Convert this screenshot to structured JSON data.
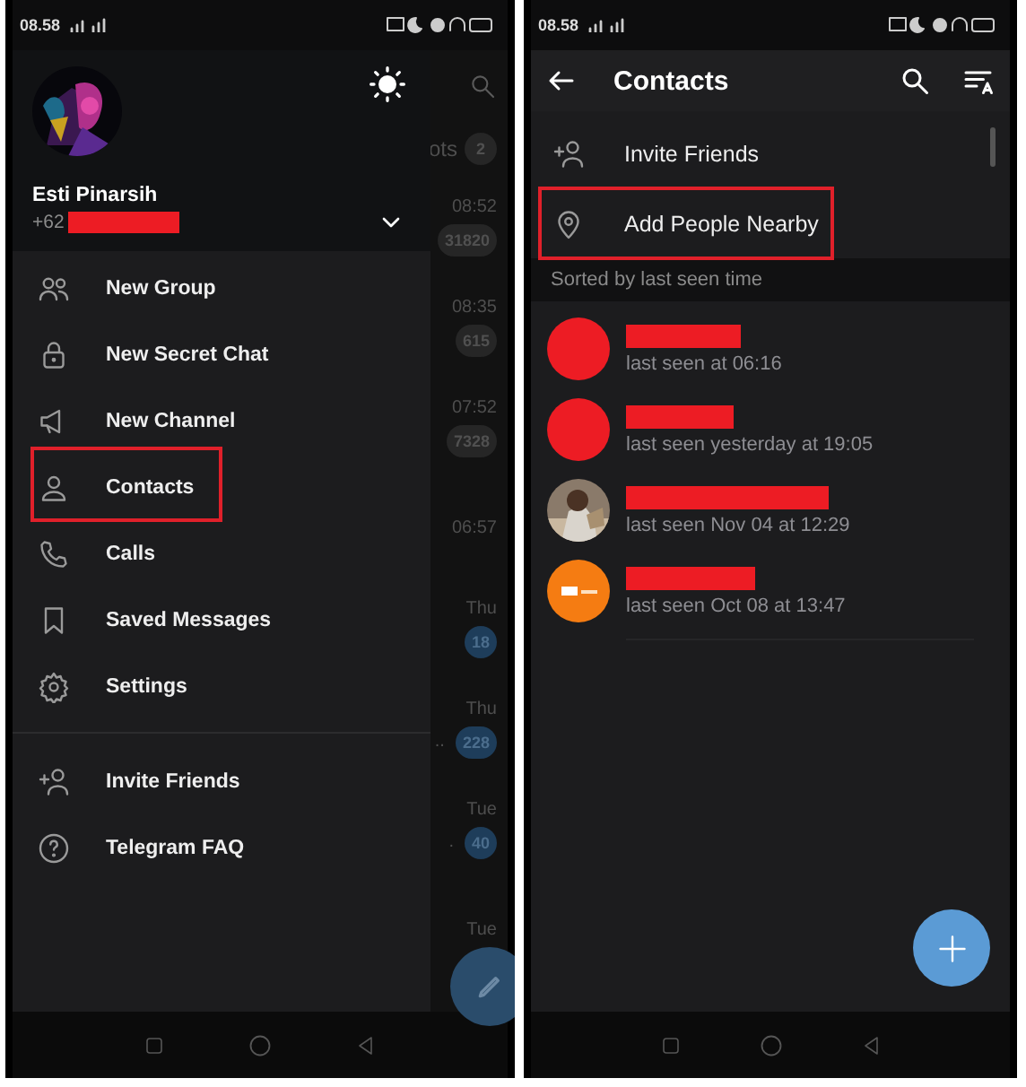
{
  "left_phone": {
    "status_bar": {
      "time": "08.58"
    },
    "behind_chats": {
      "tab": {
        "label": "ots",
        "badge": "2"
      },
      "rows": [
        {
          "time": "08:52",
          "badge": "31820",
          "muted": true
        },
        {
          "time": "08:35",
          "badge": "615",
          "muted": true
        },
        {
          "time": "07:52",
          "badge": "7328",
          "muted": true
        },
        {
          "time": "06:57"
        },
        {
          "time": "Thu",
          "badge": "18",
          "muted": false
        },
        {
          "time": "Thu",
          "badge": "228",
          "muted": false,
          "preview": ".."
        },
        {
          "time": "Tue",
          "badge": "40",
          "muted": false,
          "preview": "."
        },
        {
          "time": "Tue"
        }
      ]
    },
    "drawer": {
      "user": {
        "name": "Esti Pinarsih",
        "phone": "+62",
        "phone_redacted": true
      },
      "menu": [
        {
          "label": "New Group",
          "kind": "group",
          "highlighted": false
        },
        {
          "label": "New Secret Chat",
          "kind": "lock",
          "highlighted": false
        },
        {
          "label": "New Channel",
          "kind": "megaphone",
          "highlighted": false
        },
        {
          "label": "Contacts",
          "kind": "person",
          "highlighted": true
        },
        {
          "label": "Calls",
          "kind": "phone",
          "highlighted": false
        },
        {
          "label": "Saved Messages",
          "kind": "bookmark",
          "highlighted": false
        },
        {
          "label": "Settings",
          "kind": "gear",
          "highlighted": false
        }
      ],
      "footer_menu": [
        {
          "label": "Invite Friends",
          "kind": "invite",
          "highlighted": false
        },
        {
          "label": "Telegram FAQ",
          "kind": "help",
          "highlighted": false
        }
      ]
    }
  },
  "right_phone": {
    "status_bar": {
      "time": "08.58"
    },
    "app_bar": {
      "title": "Contacts"
    },
    "actions": [
      {
        "label": "Invite Friends",
        "kind": "invite",
        "highlighted": false
      },
      {
        "label": "Add People Nearby",
        "kind": "nearby",
        "highlighted": true
      }
    ],
    "section_header": "Sorted by last seen time",
    "contacts": [
      {
        "status": "last seen at 06:16",
        "name_redacted": true,
        "avatar": {
          "kind": "redacted",
          "color": "#ed1c24"
        }
      },
      {
        "status": "last seen yesterday at 19:05",
        "name_redacted": true,
        "avatar": {
          "kind": "redacted",
          "color": "#ed1c24"
        }
      },
      {
        "status": "last seen Nov 04 at 12:29",
        "name_redacted": true
      },
      {
        "status": "last seen Oct 08 at 13:47",
        "name_redacted": true,
        "avatar": {
          "kind": "logo",
          "color": "#f57c12"
        }
      }
    ]
  }
}
